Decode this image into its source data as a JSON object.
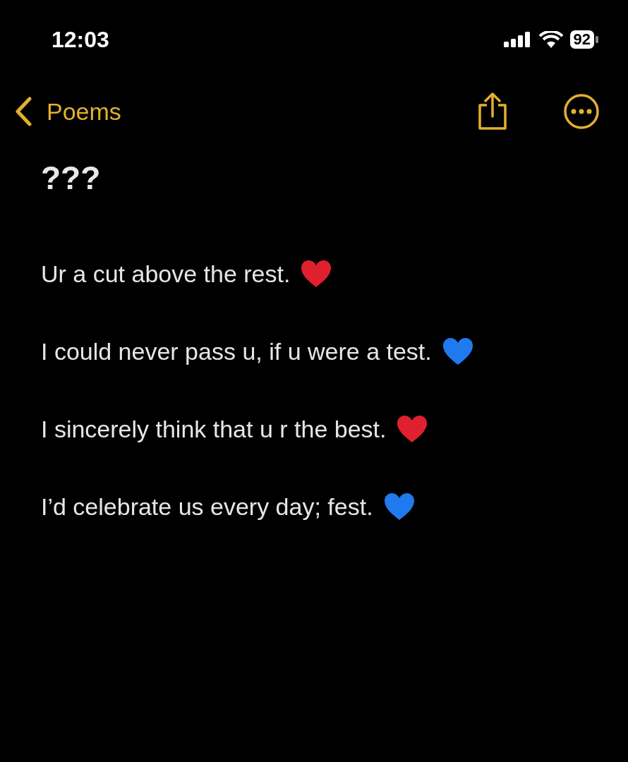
{
  "status_bar": {
    "time": "12:03",
    "battery": "92"
  },
  "nav": {
    "back_label": "Poems"
  },
  "note": {
    "title": "???",
    "lines": [
      {
        "text": "Ur a cut above the rest.",
        "color": "#e0202e"
      },
      {
        "text": "I could never pass u, if u were a test.",
        "color": "#1f7af0"
      },
      {
        "text": "I sincerely think that u r the best.",
        "color": "#e0202e"
      },
      {
        "text": "I’d celebrate us every day; fest.",
        "color": "#1f7af0"
      }
    ]
  }
}
